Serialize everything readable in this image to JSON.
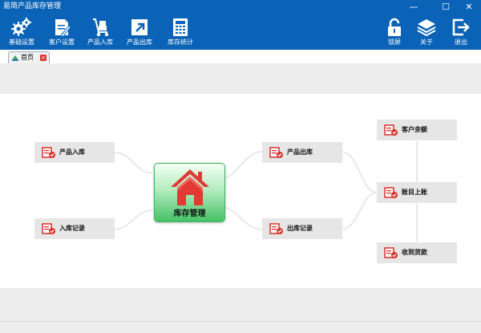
{
  "window": {
    "title": "易简产品库存管理"
  },
  "toolbar": {
    "left": [
      {
        "id": "basic-settings",
        "label": "基础设置",
        "icon": "gears-icon"
      },
      {
        "id": "customer-settings",
        "label": "客户设置",
        "icon": "document-pen-icon"
      },
      {
        "id": "product-inbound",
        "label": "产品入库",
        "icon": "hand-truck-icon"
      },
      {
        "id": "product-outbound",
        "label": "产品出库",
        "icon": "export-arrow-icon"
      },
      {
        "id": "inventory-stats",
        "label": "库存统计",
        "icon": "calculator-icon"
      }
    ],
    "right": [
      {
        "id": "lock",
        "label": "锁屏",
        "icon": "lock-icon"
      },
      {
        "id": "about",
        "label": "关于",
        "icon": "layers-icon"
      },
      {
        "id": "exit",
        "label": "退出",
        "icon": "exit-icon"
      }
    ]
  },
  "tabs": [
    {
      "label": "首页"
    }
  ],
  "flow": {
    "center_label": "库存管理",
    "nodes": [
      {
        "id": "product-inbound",
        "label": "产品入库"
      },
      {
        "id": "inbound-records",
        "label": "入库记录"
      },
      {
        "id": "product-outbound",
        "label": "产品出库"
      },
      {
        "id": "outbound-records",
        "label": "出库记录"
      },
      {
        "id": "customer-balance",
        "label": "客户余额"
      },
      {
        "id": "account-payment",
        "label": "账目上账"
      },
      {
        "id": "receive-payment",
        "label": "收到货款"
      }
    ]
  },
  "colors": {
    "titlebar": "#0b63b7",
    "node_bg": "#e6e6e6",
    "band": "#ededed",
    "accent_red": "#d9302b"
  }
}
